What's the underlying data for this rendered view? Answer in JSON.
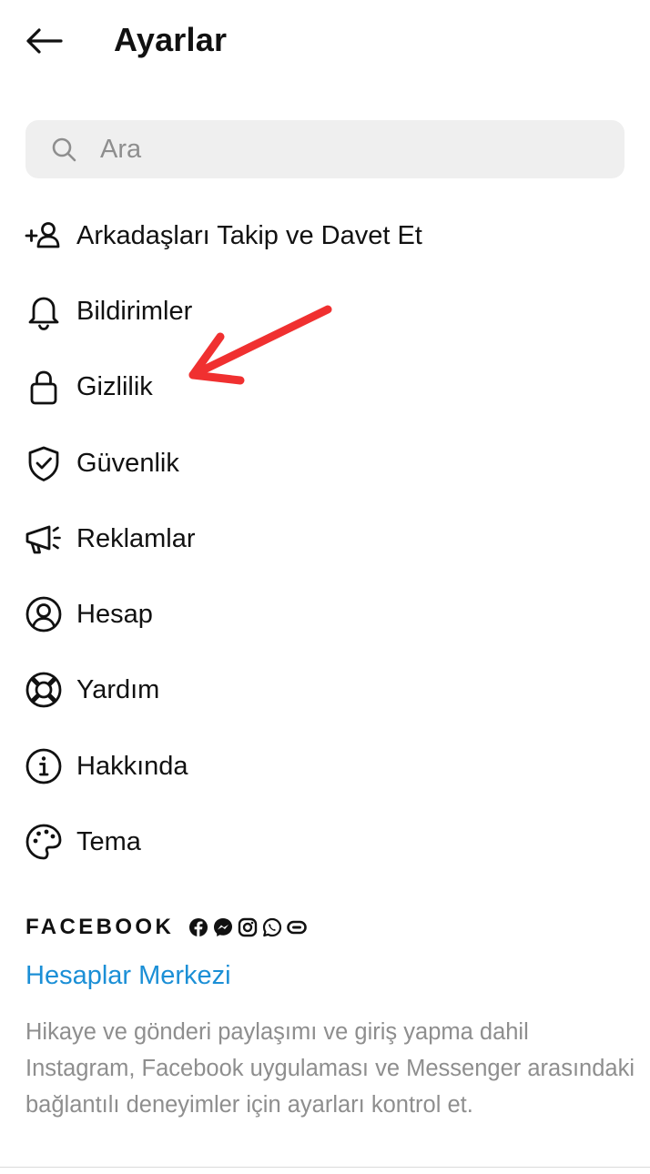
{
  "header": {
    "title": "Ayarlar",
    "back_icon": "arrow-left-icon"
  },
  "search": {
    "placeholder": "Ara",
    "value": "",
    "icon": "search-icon"
  },
  "menu": {
    "items": [
      {
        "label": "Arkadaşları Takip ve Davet Et",
        "icon": "add-person-icon"
      },
      {
        "label": "Bildirimler",
        "icon": "bell-icon"
      },
      {
        "label": "Gizlilik",
        "icon": "lock-icon"
      },
      {
        "label": "Güvenlik",
        "icon": "shield-check-icon"
      },
      {
        "label": "Reklamlar",
        "icon": "megaphone-icon"
      },
      {
        "label": "Hesap",
        "icon": "account-circle-icon"
      },
      {
        "label": "Yardım",
        "icon": "lifebuoy-icon"
      },
      {
        "label": "Hakkında",
        "icon": "info-icon"
      },
      {
        "label": "Tema",
        "icon": "palette-icon"
      }
    ]
  },
  "annotation": {
    "color": "#f03030",
    "target": "Gizlilik"
  },
  "facebook": {
    "wordmark": "FACEBOOK",
    "app_icons": [
      "facebook-icon",
      "messenger-icon",
      "instagram-icon",
      "whatsapp-icon",
      "portal-icon"
    ],
    "accounts_center_label": "Hesaplar Merkezi",
    "accounts_center_description": "Hikaye ve gönderi paylaşımı ve giriş yapma dahil Instagram, Facebook uygulaması ve Messenger arasındaki bağlantılı deneyimler için ayarları kontrol et."
  },
  "colors": {
    "link": "#1b8fd6",
    "secondary_text": "#8e8e8e",
    "search_bg": "#efefef",
    "annotation": "#f03030"
  }
}
